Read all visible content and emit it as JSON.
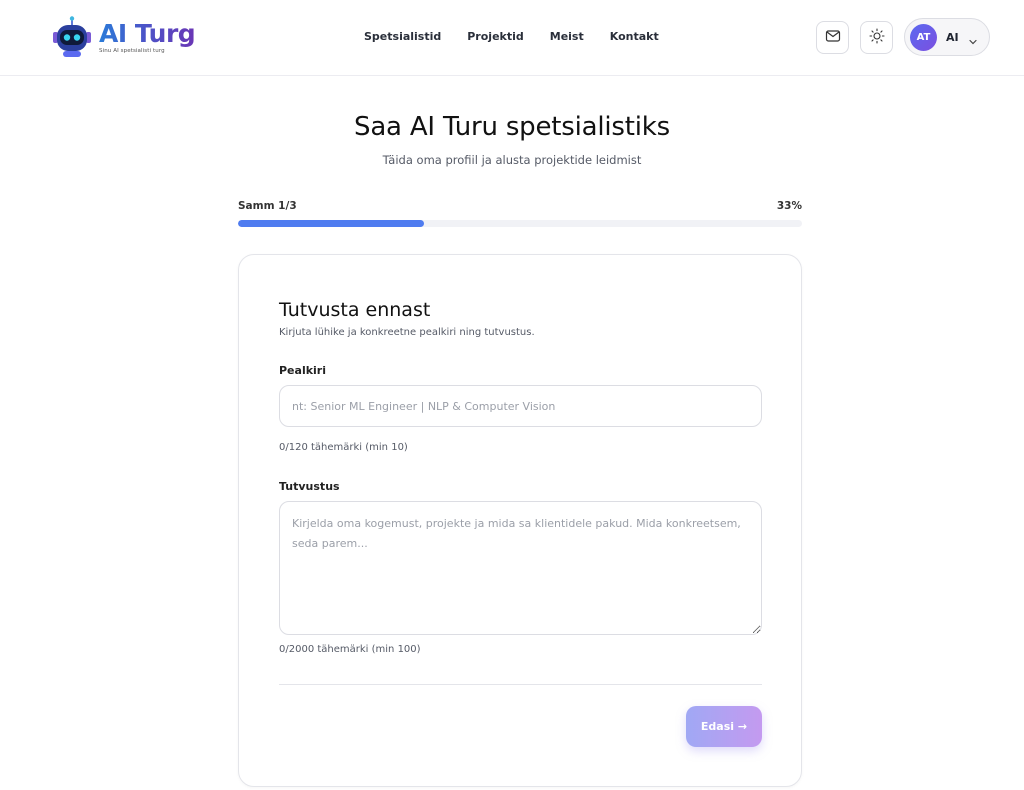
{
  "brand": {
    "title": "AI Turg",
    "subtitle": "Sinu AI spetsialisti turg"
  },
  "nav": [
    "Spetsialistid",
    "Projektid",
    "Meist",
    "Kontakt"
  ],
  "header_icons": {
    "mail": "mail-icon",
    "theme": "sun-icon"
  },
  "user": {
    "initials": "AT",
    "name": "AI"
  },
  "hero": {
    "title": "Saa AI Turu spetsialistiks",
    "subtitle": "Täida oma profiil ja alusta projektide leidmist"
  },
  "progress": {
    "label": "Samm 1/3",
    "percent_text": "33%",
    "fraction": 0.33
  },
  "card": {
    "title": "Tutvusta ennast",
    "subtitle": "Kirjuta lühike ja konkreetne pealkiri ning tutvustus.",
    "headline": {
      "label": "Pealkiri",
      "placeholder": "nt: Senior ML Engineer | NLP & Computer Vision",
      "value": "",
      "counter": "0/120 tähemärki (min 10)"
    },
    "bio": {
      "label": "Tutvustus",
      "placeholder": "Kirjelda oma kogemust, projekte ja mida sa klientidele pakud. Mida konkreetsem, seda parem...",
      "value": "",
      "counter": "0/2000 tähemärki (min 100)"
    },
    "next_label": "Edasi →"
  },
  "colors": {
    "accent": "#4f7cf0",
    "brand_purple": "#6a36b5",
    "button_from": "#a0a8f4",
    "button_to": "#c49af0"
  }
}
